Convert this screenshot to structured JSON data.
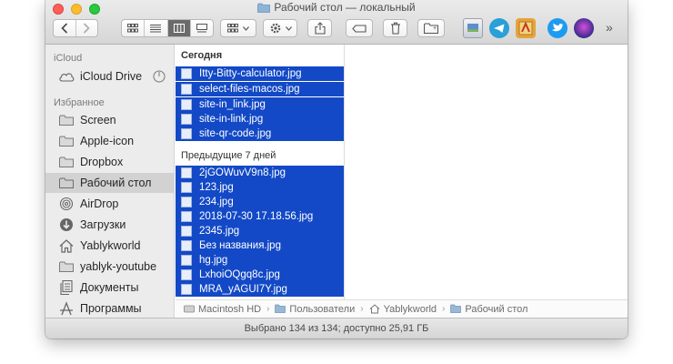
{
  "window": {
    "title": "Рабочий стол — локальный"
  },
  "toolbar": {
    "icons": [
      "back-icon",
      "forward-icon",
      "icon-view-icon",
      "list-view-icon",
      "column-view-icon",
      "gallery-view-icon",
      "group-icon",
      "gear-icon",
      "share-icon",
      "tag-icon",
      "trash-icon",
      "new-folder-icon",
      "preview-icon",
      "telegram-icon",
      "app-icon",
      "twitter-icon",
      "siri-icon",
      "more-icon"
    ],
    "more_label": "»"
  },
  "sidebar": {
    "icloud_header": "iCloud",
    "icloud_drive": "iCloud Drive",
    "favorites_header": "Избранное",
    "items": [
      {
        "label": "Screen"
      },
      {
        "label": "Apple-icon"
      },
      {
        "label": "Dropbox"
      },
      {
        "label": "Рабочий стол"
      },
      {
        "label": "AirDrop"
      },
      {
        "label": "Загрузки"
      },
      {
        "label": "Yablykworld"
      },
      {
        "label": "yablyk-youtube"
      },
      {
        "label": "Документы"
      },
      {
        "label": "Программы"
      }
    ]
  },
  "files": {
    "today_header": "Сегодня",
    "today": [
      "Itty-Bitty-calculator.jpg",
      "select-files-macos.jpg",
      "site-in_link.jpg",
      "site-in-link.jpg",
      "site-qr-code.jpg"
    ],
    "week_header": "Предыдущие 7 дней",
    "week": [
      "2jGOWuvV9n8.jpg",
      "123.jpg",
      "234.jpg",
      "2018-07-30 17.18.56.jpg",
      "2345.jpg",
      "Без названия.jpg",
      "hg.jpg",
      "LxhoiOQgq8c.jpg",
      "MRA_yAGUI7Y.jpg"
    ]
  },
  "path": [
    "Macintosh HD",
    "Пользователи",
    "Yablykworld",
    "Рабочий стол"
  ],
  "status": "Выбрано 134 из 134; доступно 25,91 ГБ",
  "colors": {
    "selection": "#1349c6",
    "sidebar_bg": "#ececec",
    "folder": "#9ab7d6"
  }
}
